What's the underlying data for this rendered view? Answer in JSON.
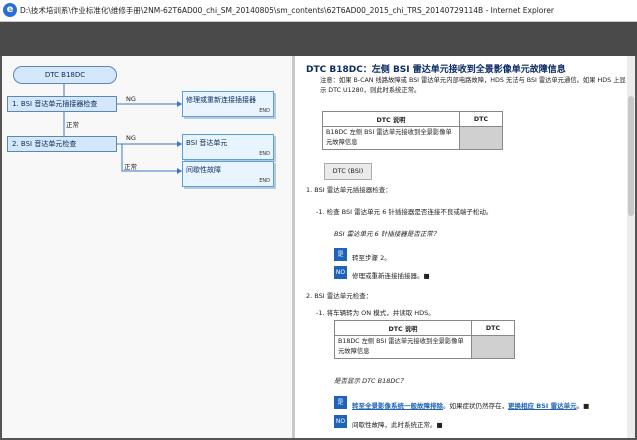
{
  "window": {
    "title": "D:\\技术培训系\\作业标准化\\维修手册\\2NM-62T6AD00_chi_SM_20140805\\sm_contents\\62T6AD00_2015_chi_TRS_20140729114B - Internet Explorer",
    "app_icon": "ie-icon"
  },
  "flowchart": {
    "start": "DTC B18DC",
    "step1": "1.  BSI 音达单元插接器检查",
    "step2": "2.  BSI 音达单元检查",
    "ng1": "NG",
    "ok1": "正常",
    "ng2": "NG",
    "ok2": "正常",
    "end1": "修理或重新连接插接器",
    "end2": "BSI 音达单元",
    "end3": "间歇性故障",
    "end_tag": "END"
  },
  "content": {
    "heading": "DTC B18DC：左侧 BSI 雷达单元接收到全景影像单元故障信息",
    "note": "注意：如果 B-CAN 线路故障或 BSI 雷达单元内部电路故障，HDS 无法与 BSI 雷达单元通信。如果 HDS 上显示 DTC U1280，则此时系统正常。",
    "table1": {
      "col1": "DTC 说明",
      "col2": "DTC",
      "desc": "B18DC 左侧 BSI 雷达单元接收到全景影像单元故障信息"
    },
    "dtc_button": "DTC (BSI)",
    "step1_title": "1.   BSI 雷达单元插接器检查：",
    "step1_sub": "-1.   检查 BSI 雷达单元 6 针插接器是否连接不良或端子松动。",
    "step1_q": "BSI 雷达单元 6 针插接器是否正常？",
    "yes_label": "是",
    "no_label": "NO",
    "step1_yes": "转至步骤 2。",
    "step1_no": "修理或重新连接插接器。■",
    "step2_title": "2.   BSI 雷达单元检查：",
    "step2_sub": "-1.   将车辆转为 ON 模式，并读取 HDS。",
    "table2": {
      "col1": "DTC 说明",
      "col2": "DTC",
      "desc": "B18DC 左侧 BSI 雷达单元接收到全景影像单元故障信息"
    },
    "step2_q": "是否显示 DTC B18DC？",
    "step2_yes_link": "转至全景影像系统一般故障排除",
    "step2_yes_mid": "。如果症状仍然存在，",
    "step2_yes_link2": "更换相应 BSI 雷达单元",
    "step2_yes_end": "。■",
    "step2_no": "间歇性故障，此时系统正常。■"
  }
}
